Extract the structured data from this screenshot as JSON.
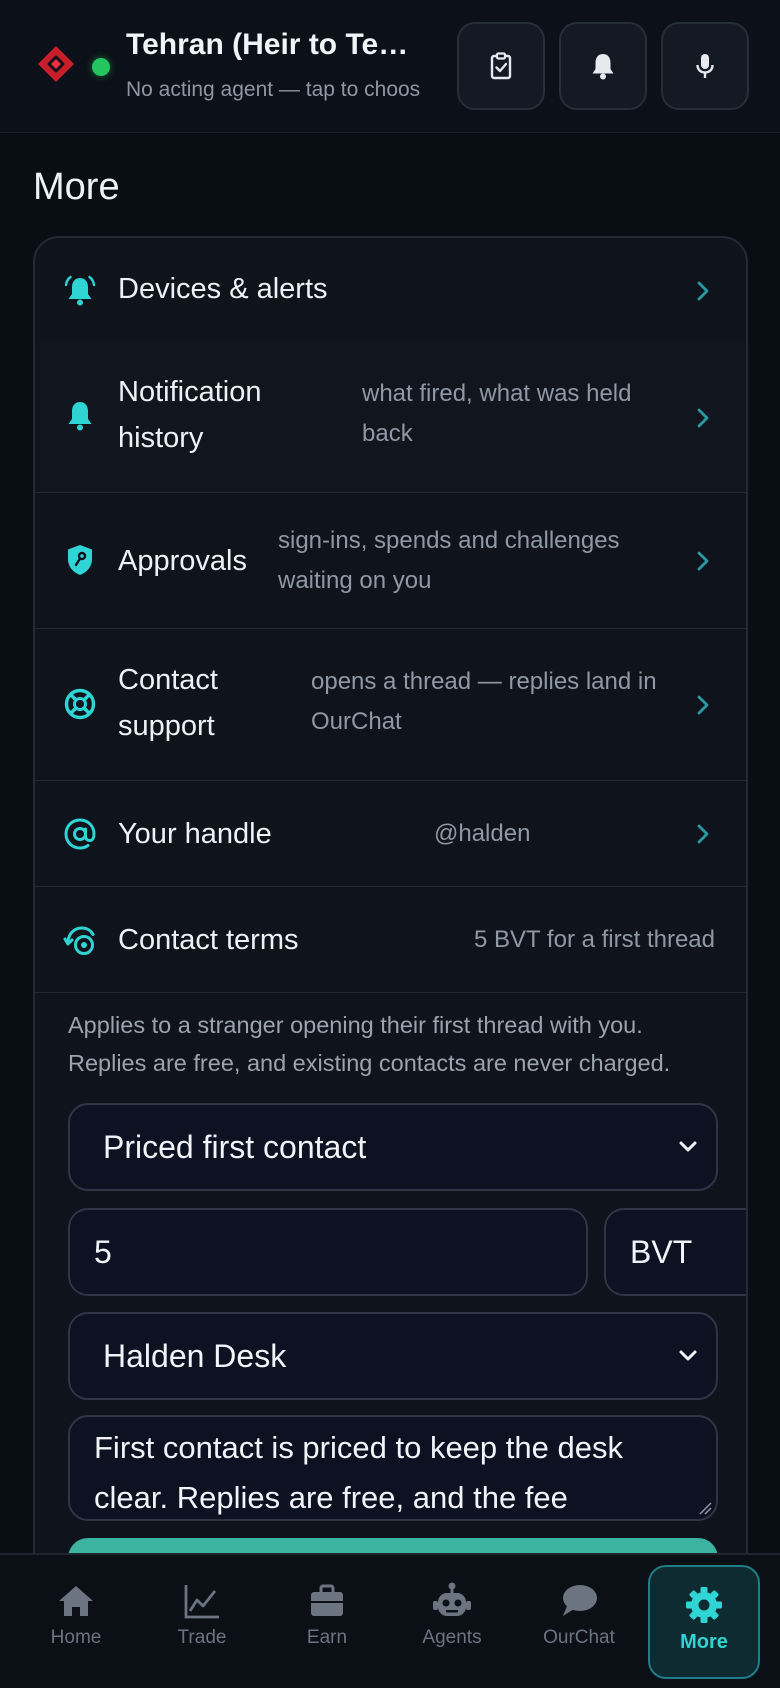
{
  "header": {
    "title": "Tehran (Heir to Te…",
    "subtitle": "No acting agent — tap to choos",
    "buttons": [
      "tasks",
      "notifications",
      "voice"
    ]
  },
  "page": {
    "title": "More"
  },
  "rows": [
    {
      "label": "Devices & alerts",
      "hint": ""
    },
    {
      "label": "Notification history",
      "hint": "what fired, what was held back"
    },
    {
      "label": "Approvals",
      "hint": "sign-ins, spends and challenges waiting on you"
    },
    {
      "label": "Contact support",
      "hint": "opens a thread — replies land in OurChat"
    },
    {
      "label": "Your handle",
      "hint": "@halden"
    },
    {
      "label": "Contact terms",
      "hint": "5 BVT for a first thread"
    }
  ],
  "contact_terms": {
    "description": "Applies to a stranger opening their first thread with you. Replies are free, and existing contacts are never charged.",
    "mode_selected": "Priced first contact",
    "amount": "5",
    "currency": "BVT",
    "recipient_selected": "Halden Desk",
    "message": "First contact is priced to keep the desk clear. Replies are free, and the fee"
  },
  "nav": [
    {
      "label": "Home"
    },
    {
      "label": "Trade"
    },
    {
      "label": "Earn"
    },
    {
      "label": "Agents"
    },
    {
      "label": "OurChat"
    },
    {
      "label": "More"
    }
  ],
  "colors": {
    "accent": "#2fd4d4",
    "status": "#22c55e",
    "button": "#3bb3a0"
  }
}
